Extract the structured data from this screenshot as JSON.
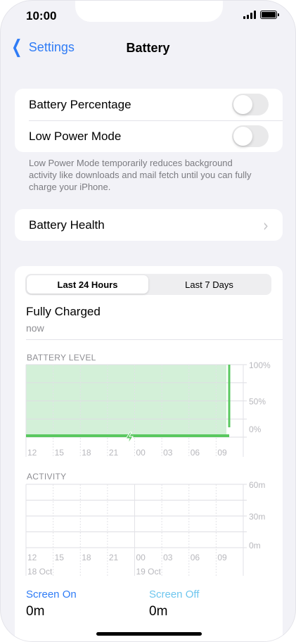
{
  "status": {
    "time": "10:00"
  },
  "nav": {
    "back_label": "Settings",
    "title": "Battery"
  },
  "settings": {
    "battery_percentage_label": "Battery Percentage",
    "battery_percentage_on": false,
    "low_power_label": "Low Power Mode",
    "low_power_on": false,
    "footnote": "Low Power Mode temporarily reduces background activity like downloads and mail fetch until you can fully charge your iPhone.",
    "battery_health_label": "Battery Health"
  },
  "usage": {
    "tabs": [
      "Last 24 Hours",
      "Last 7 Days"
    ],
    "selected_tab": "Last 24 Hours",
    "status_title": "Fully Charged",
    "status_time": "now",
    "battery_section": "BATTERY LEVEL",
    "activity_section": "ACTIVITY",
    "screen_on_label": "Screen On",
    "screen_on_value": "0m",
    "screen_off_label": "Screen Off",
    "screen_off_value": "0m"
  },
  "colors": {
    "accent": "#2f7cf6",
    "battery_fill": "#d3f0d8",
    "battery_line": "#5ac860",
    "screen_on": "#2f7cf6",
    "screen_off": "#6ec6ee"
  },
  "icons": [
    "chevron-left-icon",
    "chevron-right-icon",
    "signal-icon",
    "battery-icon",
    "charging-bolt-icon"
  ],
  "chart_data": [
    {
      "type": "area",
      "title": "BATTERY LEVEL",
      "x": [
        "12",
        "15",
        "18",
        "21",
        "00",
        "03",
        "06",
        "09"
      ],
      "y_ticks": [
        "100%",
        "50%",
        "0%"
      ],
      "ylim": [
        0,
        100
      ],
      "series": [
        {
          "values": [
            100,
            100,
            100,
            100,
            100,
            100,
            100,
            100
          ]
        }
      ],
      "charging_indicator": true,
      "grid": true
    },
    {
      "type": "bar",
      "title": "ACTIVITY",
      "x": [
        "12",
        "15",
        "18",
        "21",
        "00",
        "03",
        "06",
        "09"
      ],
      "x_date_labels": [
        "18 Oct",
        "19 Oct"
      ],
      "y_ticks": [
        "60m",
        "30m",
        "0m"
      ],
      "ylim": [
        0,
        60
      ],
      "series": [
        {
          "name": "Screen On",
          "values": [
            0,
            0,
            0,
            0,
            0,
            0,
            0,
            0
          ]
        },
        {
          "name": "Screen Off",
          "values": [
            0,
            0,
            0,
            0,
            0,
            0,
            0,
            0
          ]
        }
      ],
      "grid": true
    }
  ]
}
